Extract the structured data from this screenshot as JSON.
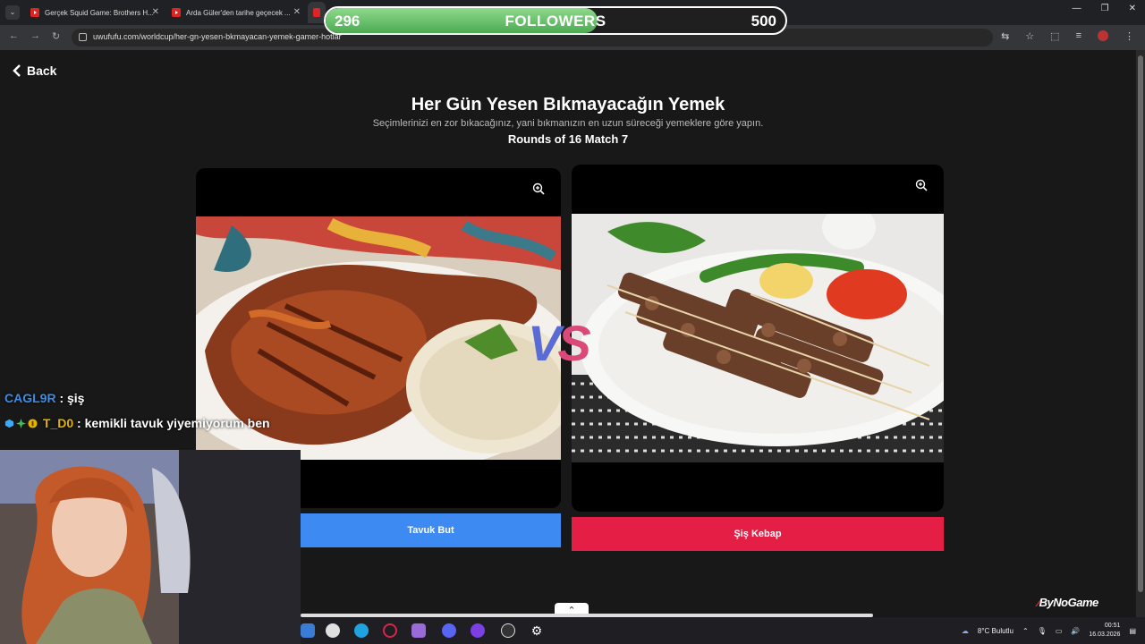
{
  "browser": {
    "tabs": [
      {
        "title": "Gerçek Squid Game: Brothers H..."
      },
      {
        "title": "Arda Güler'den tarihe geçecek ..."
      }
    ],
    "url": "uwufufu.com/worldcup/her-gn-yesen-bkmayacan-yemek-gamer-hotlar"
  },
  "followers_goal": {
    "current": "296",
    "label": "FOLLOWERS",
    "target": "500",
    "progress": 0.592,
    "color": "#5cb85c"
  },
  "page": {
    "back_label": "Back",
    "title": "Her Gün Yesen Bıkmayacağın Yemek",
    "subtitle": "Seçimlerinizi en zor bıkacağınız, yani bıkmanızın en uzun süreceği yemeklere göre yapın.",
    "round": "Rounds of 16 Match 7",
    "vs": "VS",
    "choices": [
      {
        "label": "Tavuk But",
        "color": "#3d8bf2"
      },
      {
        "label": "Şiş Kebap",
        "color": "#e41e45"
      }
    ]
  },
  "chat": [
    {
      "user": "CAGL9R",
      "message": ": şiş"
    },
    {
      "user": "T_D0",
      "message": ": kemikli tavuk yiyemiyorum ben"
    }
  ],
  "logo": "ByNoGame",
  "taskbar": {
    "weather": "8°C  Bulutlu",
    "time": "00:51",
    "date": "16.03.2026"
  }
}
